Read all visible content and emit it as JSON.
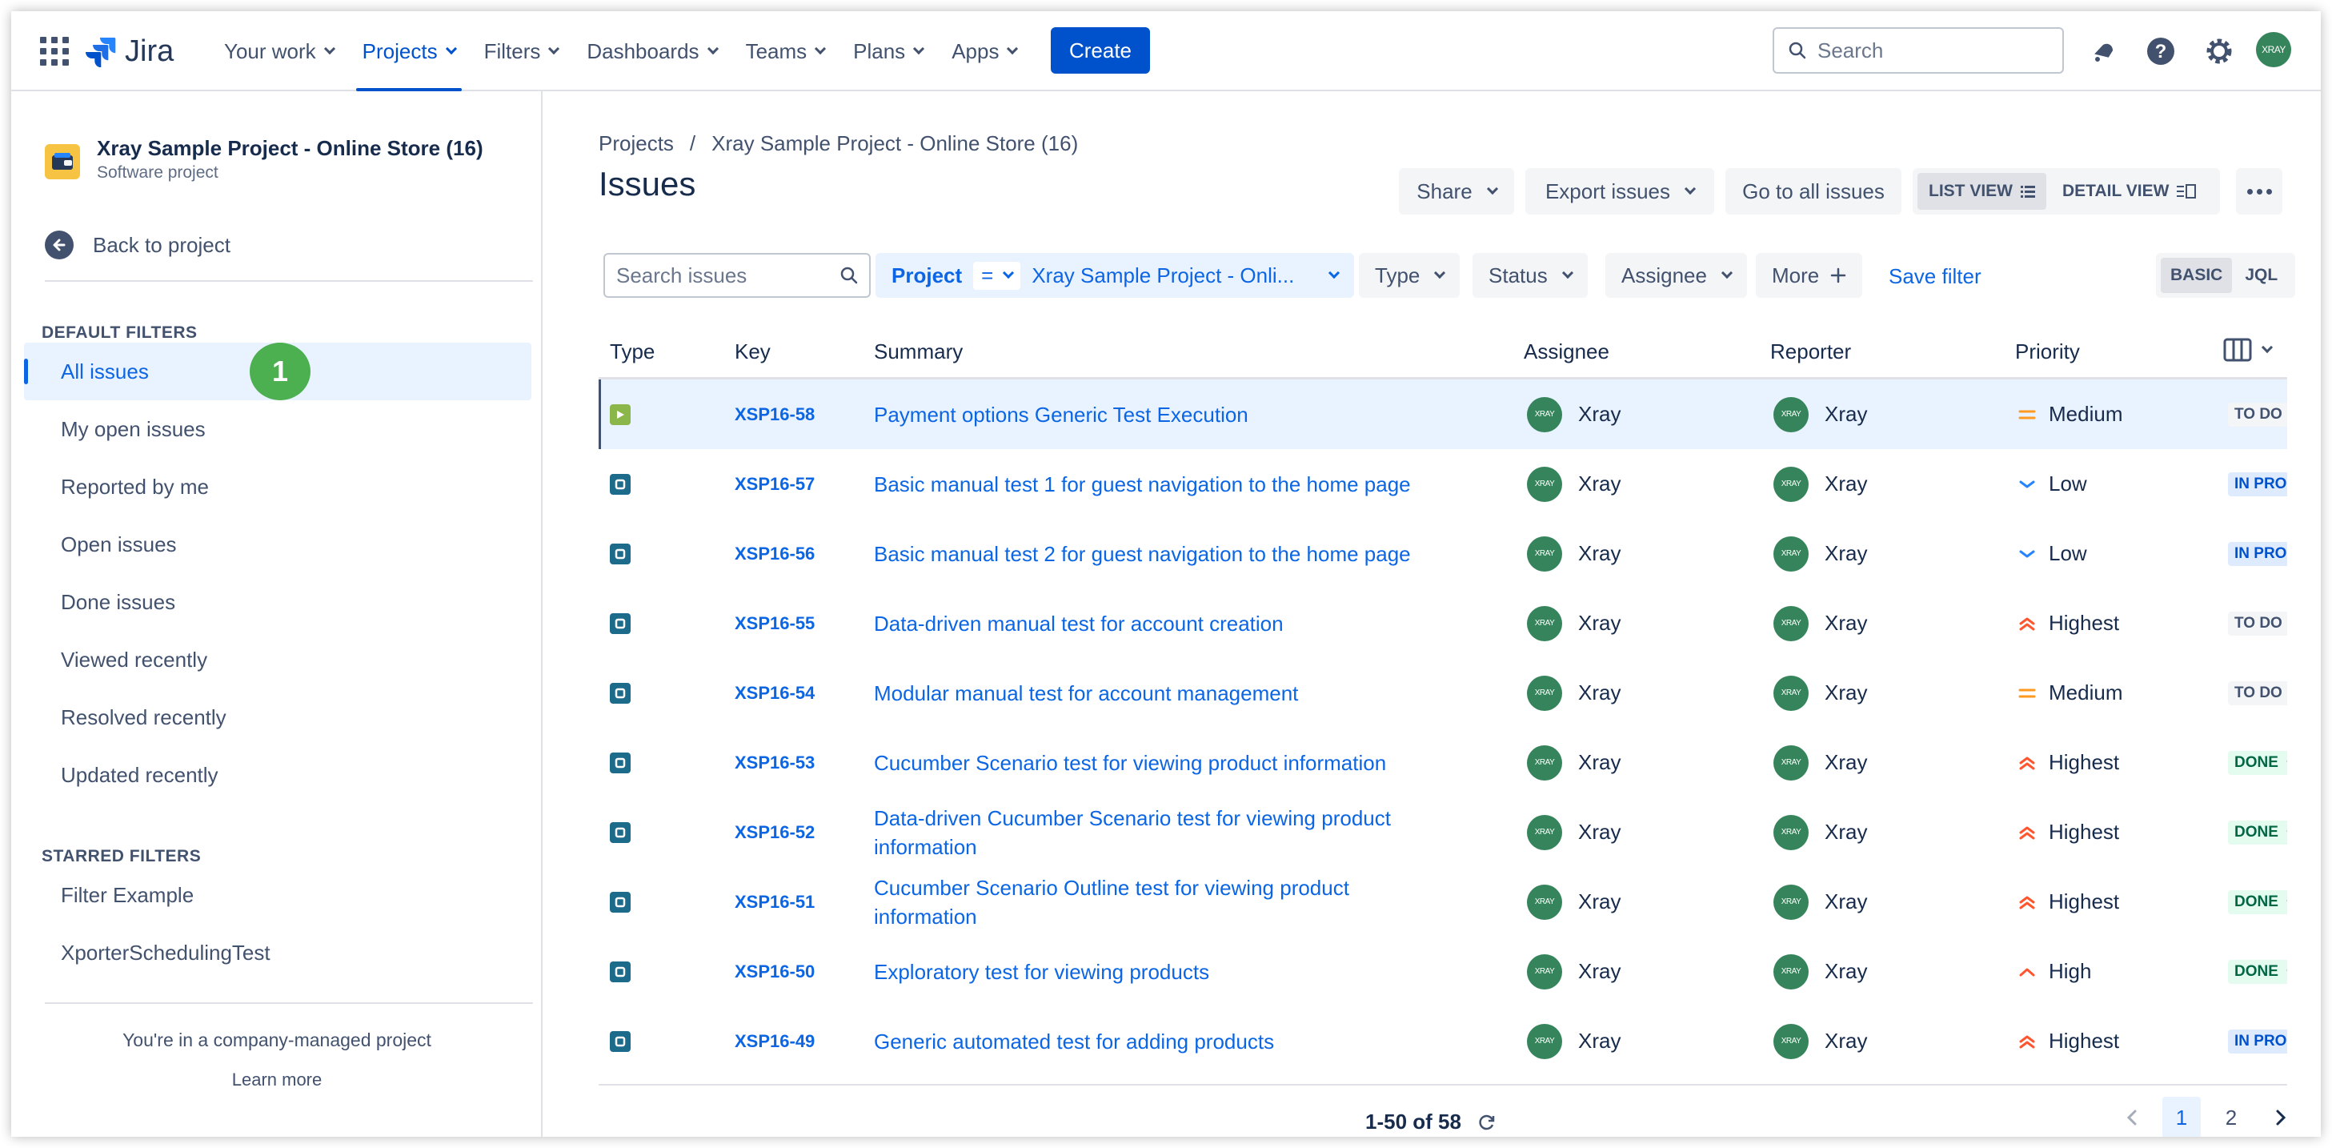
{
  "topnav": {
    "logo_text": "Jira",
    "items": [
      {
        "label": "Your work"
      },
      {
        "label": "Projects",
        "active": true
      },
      {
        "label": "Filters"
      },
      {
        "label": "Dashboards"
      },
      {
        "label": "Teams"
      },
      {
        "label": "Plans"
      },
      {
        "label": "Apps"
      }
    ],
    "create_label": "Create",
    "search_placeholder": "Search",
    "avatar_initials": "XRAY",
    "accent_color": "#0052cc"
  },
  "sidebar": {
    "project_name": "Xray Sample Project - Online Store (16)",
    "project_type": "Software project",
    "back_label": "Back to project",
    "default_filters_heading": "DEFAULT FILTERS",
    "default_filters": [
      {
        "label": "All issues",
        "active": true
      },
      {
        "label": "My open issues"
      },
      {
        "label": "Reported by me"
      },
      {
        "label": "Open issues"
      },
      {
        "label": "Done issues"
      },
      {
        "label": "Viewed recently"
      },
      {
        "label": "Resolved recently"
      },
      {
        "label": "Updated recently"
      }
    ],
    "callout_number": "1",
    "starred_filters_heading": "STARRED FILTERS",
    "starred_filters": [
      {
        "label": "Filter Example"
      },
      {
        "label": "XporterSchedulingTest"
      }
    ],
    "footer_text": "You're in a company-managed project",
    "footer_link": "Learn more"
  },
  "main": {
    "breadcrumb": [
      "Projects",
      "/",
      "Xray Sample Project - Online Store (16)"
    ],
    "title": "Issues",
    "actions": {
      "share": "Share",
      "export": "Export issues",
      "go_all": "Go to all issues",
      "list_view": "LIST VIEW",
      "detail_view": "DETAIL VIEW"
    },
    "filters": {
      "search_placeholder": "Search issues",
      "project_label": "Project",
      "project_operator": "=",
      "project_value": "Xray Sample Project - Onli...",
      "type": "Type",
      "status": "Status",
      "assignee": "Assignee",
      "more": "More",
      "save_filter": "Save filter",
      "basic": "BASIC",
      "jql": "JQL"
    },
    "columns": [
      "Type",
      "Key",
      "Summary",
      "Assignee",
      "Reporter",
      "Priority"
    ],
    "rows": [
      {
        "type": "exec",
        "key": "XSP16-58",
        "summary": "Payment options Generic Test Execution",
        "assignee": "Xray",
        "reporter": "Xray",
        "priority": "Medium",
        "status": "TO DO",
        "status_kind": "todo",
        "selected": true
      },
      {
        "type": "test",
        "key": "XSP16-57",
        "summary": "Basic manual test 1 for guest navigation to the home page",
        "assignee": "Xray",
        "reporter": "Xray",
        "priority": "Low",
        "status": "IN PROG",
        "status_kind": "inprog"
      },
      {
        "type": "test",
        "key": "XSP16-56",
        "summary": "Basic manual test 2 for guest navigation to the home page",
        "assignee": "Xray",
        "reporter": "Xray",
        "priority": "Low",
        "status": "IN PROG",
        "status_kind": "inprog"
      },
      {
        "type": "test",
        "key": "XSP16-55",
        "summary": "Data-driven manual test for account creation",
        "assignee": "Xray",
        "reporter": "Xray",
        "priority": "Highest",
        "status": "TO DO",
        "status_kind": "todo"
      },
      {
        "type": "test",
        "key": "XSP16-54",
        "summary": "Modular manual test for account management",
        "assignee": "Xray",
        "reporter": "Xray",
        "priority": "Medium",
        "status": "TO DO",
        "status_kind": "todo"
      },
      {
        "type": "test",
        "key": "XSP16-53",
        "summary": "Cucumber Scenario test for viewing product information",
        "assignee": "Xray",
        "reporter": "Xray",
        "priority": "Highest",
        "status": "DONE",
        "status_kind": "done"
      },
      {
        "type": "test",
        "key": "XSP16-52",
        "summary": "Data-driven Cucumber Scenario test for viewing product information",
        "assignee": "Xray",
        "reporter": "Xray",
        "priority": "Highest",
        "status": "DONE",
        "status_kind": "done"
      },
      {
        "type": "test",
        "key": "XSP16-51",
        "summary": "Cucumber Scenario Outline test for viewing product information",
        "assignee": "Xray",
        "reporter": "Xray",
        "priority": "Highest",
        "status": "DONE",
        "status_kind": "done"
      },
      {
        "type": "test",
        "key": "XSP16-50",
        "summary": "Exploratory test for viewing products",
        "assignee": "Xray",
        "reporter": "Xray",
        "priority": "High",
        "status": "DONE",
        "status_kind": "done"
      },
      {
        "type": "test",
        "key": "XSP16-49",
        "summary": "Generic automated test for adding products",
        "assignee": "Xray",
        "reporter": "Xray",
        "priority": "Highest",
        "status": "IN PROG",
        "status_kind": "inprog"
      }
    ],
    "pagination": {
      "count": "1-50 of 58",
      "pages": [
        "1",
        "2"
      ],
      "current": "1"
    }
  }
}
